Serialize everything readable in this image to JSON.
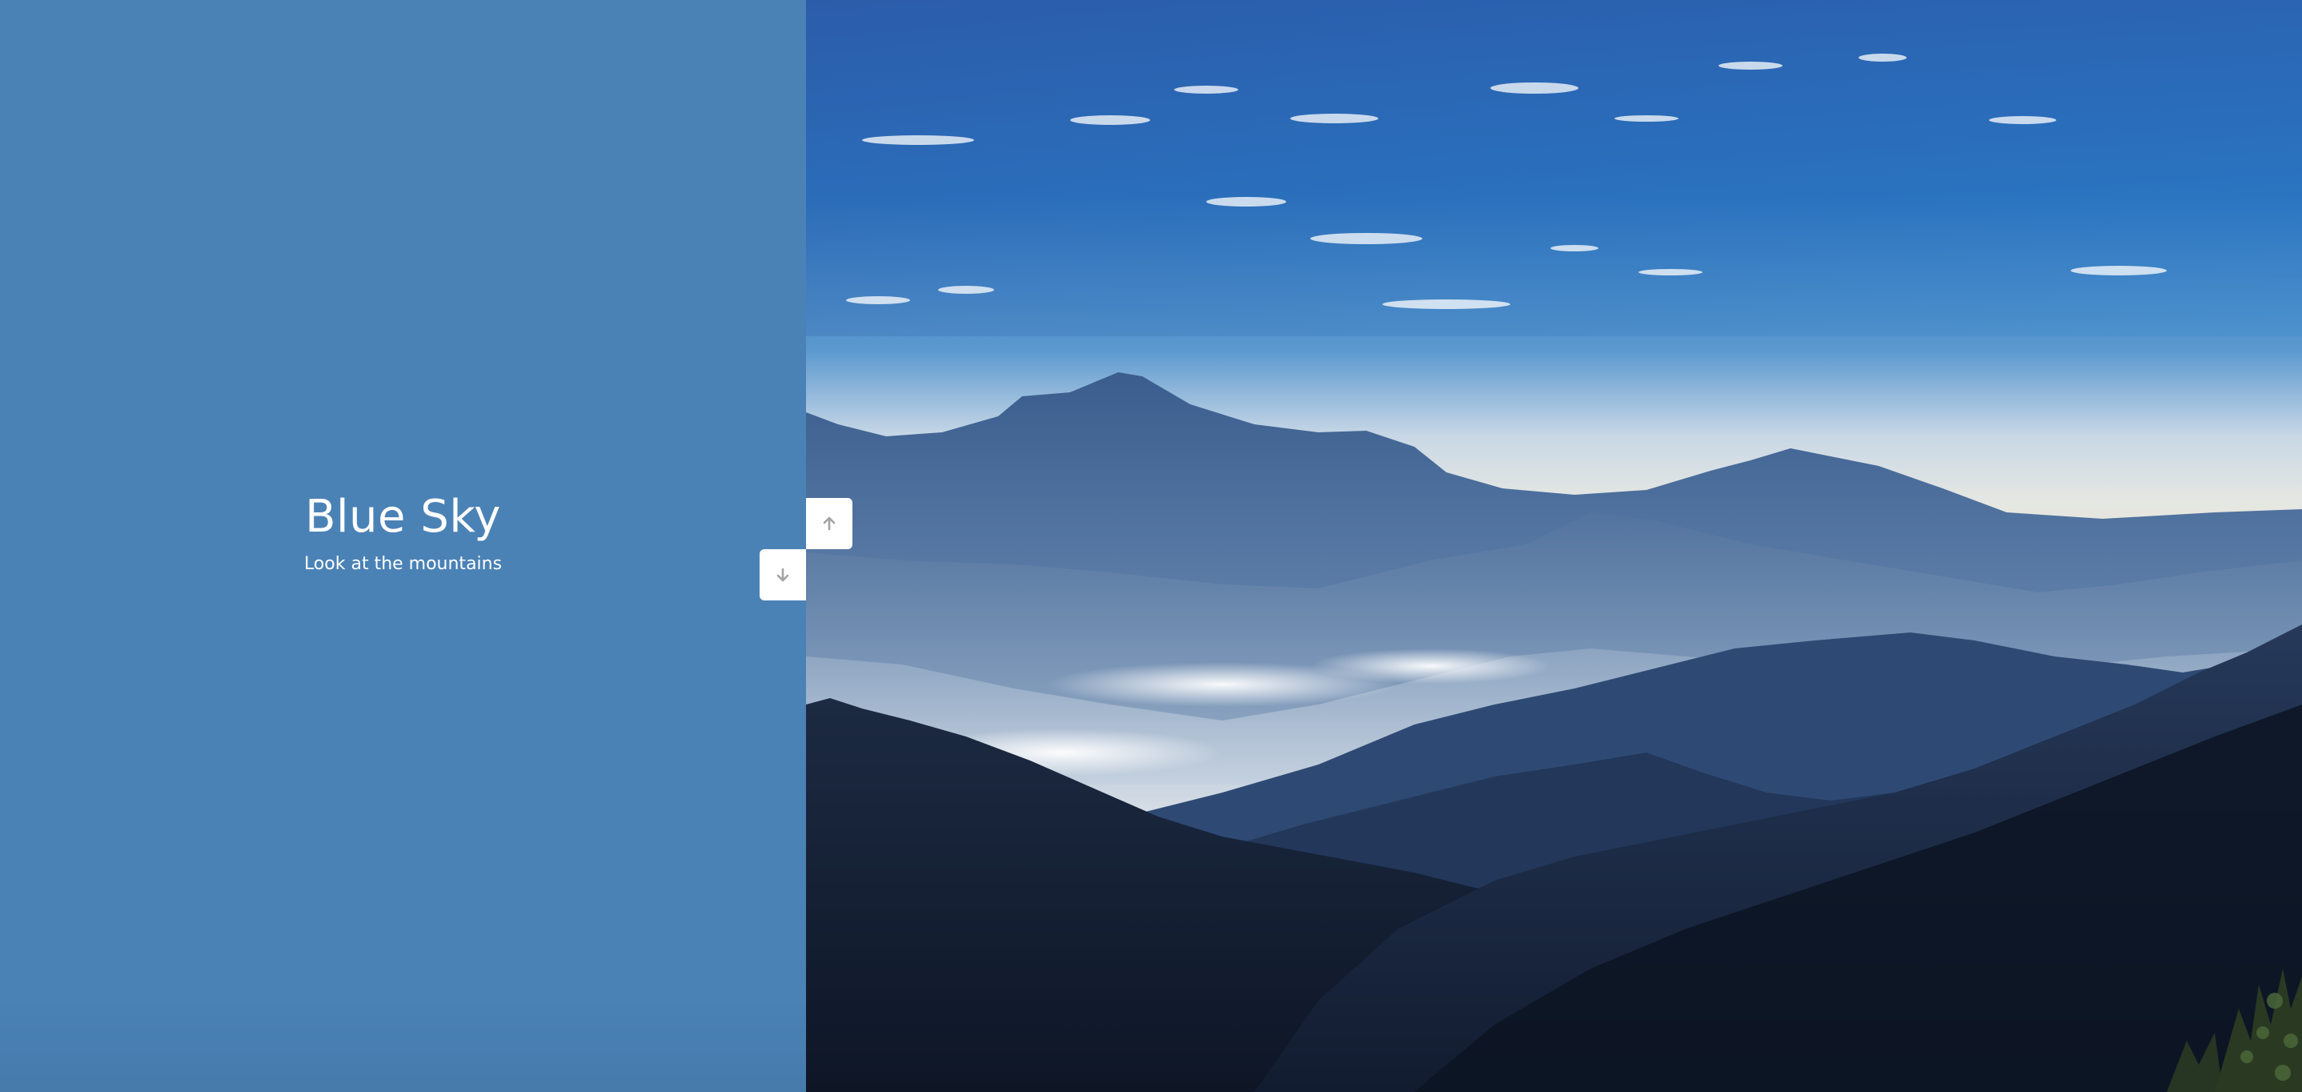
{
  "slide": {
    "title": "Blue Sky",
    "subtitle": "Look at the mountains"
  },
  "colors": {
    "left_panel": "#4a82b6",
    "text": "#ffffff",
    "arrow": "#a3a3a3"
  },
  "icons": {
    "up": "arrow-up-icon",
    "down": "arrow-down-icon"
  }
}
